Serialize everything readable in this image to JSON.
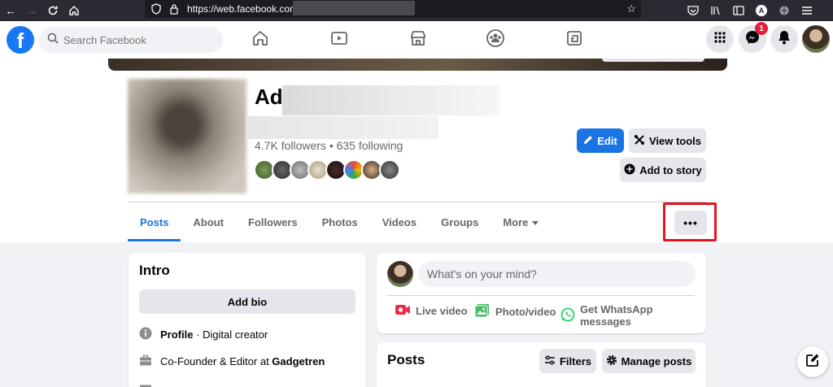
{
  "browser": {
    "url": "https://web.facebook.com/"
  },
  "header": {
    "search_placeholder": "Search Facebook",
    "messenger_badge": "1"
  },
  "profile": {
    "name_visible": "Ad",
    "followers_line": "4.7K followers • 635 following",
    "buttons": {
      "edit": "Edit",
      "view_tools": "View tools",
      "add_to_story": "Add to story"
    },
    "tabs": [
      "Posts",
      "About",
      "Followers",
      "Photos",
      "Videos",
      "Groups",
      "More"
    ],
    "active_tab": "Posts",
    "more_menu": "•••"
  },
  "intro": {
    "title": "Intro",
    "add_bio": "Add bio",
    "profile_label": "Profile",
    "profile_value": " · Digital creator",
    "work_prefix": "Co-Founder & Editor at ",
    "work_company": "Gadgetren"
  },
  "composer": {
    "placeholder": "What's on your mind?",
    "live_video": "Live video",
    "photo_video": "Photo/video",
    "whatsapp": "Get WhatsApp messages"
  },
  "posts": {
    "title": "Posts",
    "filters": "Filters",
    "manage_posts": "Manage posts"
  },
  "colors": {
    "brand": "#1877f2",
    "primary_button": "#1b74e4",
    "highlight": "#e0141e",
    "badge": "#e41e3f"
  }
}
